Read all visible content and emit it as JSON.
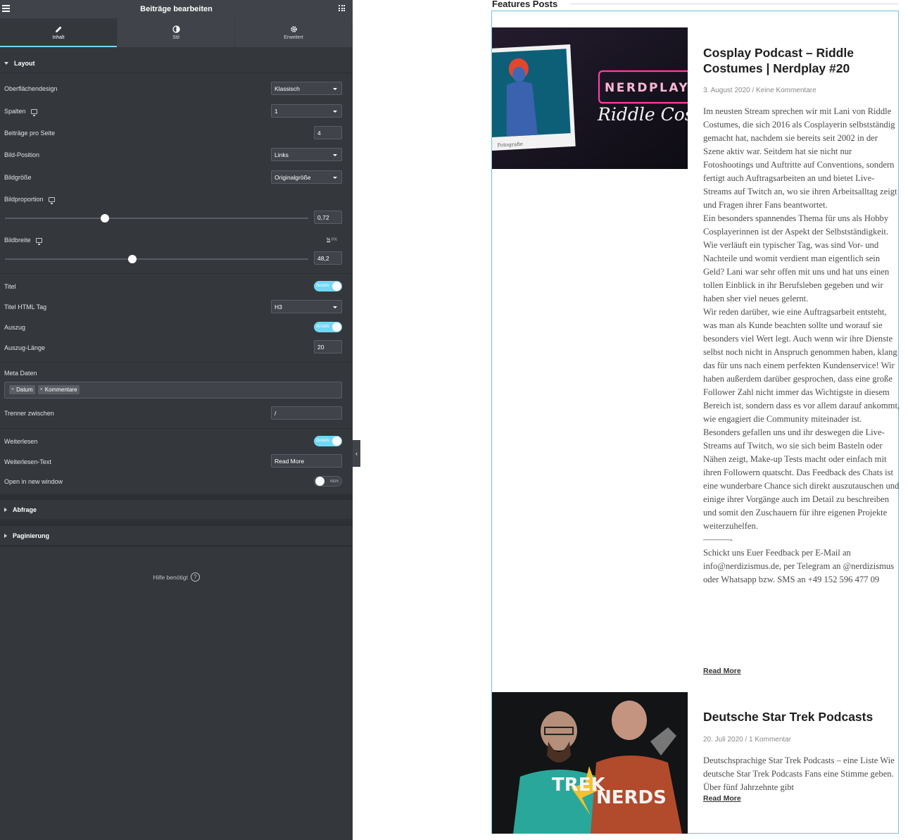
{
  "panel": {
    "title": "Beiträge bearbeiten",
    "tabs": [
      {
        "label": "Inhalt",
        "icon": "pencil-icon"
      },
      {
        "label": "Stil",
        "icon": "contrast-icon"
      },
      {
        "label": "Erweitert",
        "icon": "gear-icon"
      }
    ],
    "layout": {
      "heading": "Layout",
      "surface_label": "Oberflächendesign",
      "surface_value": "Klassisch",
      "columns_label": "Spalten",
      "columns_value": "1",
      "posts_per_page_label": "Beiträge pro Seite",
      "posts_per_page_value": "4",
      "image_position_label": "Bild-Position",
      "image_position_value": "Links",
      "image_size_label": "Bildgröße",
      "image_size_value": "Originalgröße",
      "image_ratio_label": "Bildproportion",
      "image_ratio_value": "0,72",
      "image_ratio_fraction": 0.33,
      "image_width_label": "Bildbreite",
      "image_width_value": "48,2",
      "image_width_fraction": 0.42,
      "image_width_units": [
        "%",
        "PX"
      ],
      "title_label": "Titel",
      "title_toggle": "ZEIGEN",
      "title_tag_label": "Titel HTML Tag",
      "title_tag_value": "H3",
      "excerpt_label": "Auszug",
      "excerpt_toggle": "ZEIGEN",
      "excerpt_length_label": "Auszug-Länge",
      "excerpt_length_value": "20",
      "meta_label": "Meta Daten",
      "meta_tags": [
        "Datum",
        "Kommentare"
      ],
      "separator_label": "Trenner zwischen",
      "separator_value": "/",
      "read_more_label": "Weiterlesen",
      "read_more_toggle": "ZEIGEN",
      "read_more_text_label": "Weiterlesen-Text",
      "read_more_text_value": "Read More",
      "new_window_label": "Open in new window",
      "new_window_toggle": "NEIN"
    },
    "query_heading": "Abfrage",
    "pagination_heading": "Paginierung",
    "help": "Hilfe benötigt"
  },
  "preview": {
    "section_title": "Features Posts",
    "posts": [
      {
        "title": "Cosplay Podcast – Riddle Costumes | Nerdplay #20",
        "meta": "3. August 2020 / Keine Kommentare",
        "excerpt": "Im neusten Stream sprechen wir mit Lani von Riddle Costumes, die sich 2016 als Cosplayerin selbstständig gemacht hat, nachdem sie bereits seit 2002 in der Szene aktiv war. Seitdem hat sie nicht nur Fotoshootings und Auftritte auf Conventions, sondern fertigt auch Auftragsarbeiten an und bietet Live-Streams auf Twitch an, wo sie ihren Arbeitsalltag zeigt und Fragen ihrer Fans beantwortet.\nEin besonders spannendes Thema für uns als Hobby Cosplayerinnen ist der Aspekt der Selbstständigkeit. Wie verläuft ein typischer Tag, was sind Vor- und Nachteile und womit verdient man eigentlich sein Geld? Lani war sehr offen mit uns und hat uns einen tollen Einblick in ihr Berufsleben gegeben und wir haben sher viel neues gelernt.\nWir reden darüber, wie eine Auftragsarbeit entsteht, was man als Kunde beachten sollte und worauf sie besonders viel Wert legt. Auch wenn wir ihre Dienste selbst noch nicht in Anspruch genommen haben, klang das für uns nach einem perfekten Kundenservice! Wir haben außerdem darüber gesprochen, dass eine große Follower Zahl nicht immer das Wichtigste in diesem Bereich ist, sondern dass es vor allem darauf ankommt, wie engagiert die Community miteinader ist.\nBesonders gefallen uns und ihr deswegen die Live-Streams auf Twitch, wo sie sich beim Basteln oder Nähen zeigt, Make-up Tests macht oder einfach mit ihren Followern quatscht. Das Feedback des Chats ist eine wunderbare Chance sich direkt auszutauschen und einige ihrer Vorgänge auch im Detail zu beschreiben und somit den Zuschauern für ihre eigenen Projekte weiterzuhelfen.\n———-\nSchickt uns Euer Feedback per E-Mail an info@nerdizismus.de, per Telegram an @nerdizismus oder Whatsapp bzw. SMS an +49 152 596 477 09",
        "read_more": "Read More",
        "image_text_1": "NERDPLAY",
        "image_text_2": "Riddle Costum"
      },
      {
        "title": "Deutsche Star Trek Podcasts",
        "meta": "20. Juli 2020 / 1 Kommentar",
        "excerpt": "Deutschsprachige Star Trek Podcasts – eine Liste Wie deutsche Star Trek Podcasts Fans eine Stimme geben. Über fünf Jahrzehnte gibt",
        "read_more": "Read More",
        "image_text_1": "TREK",
        "image_text_2": "NERDS"
      }
    ]
  }
}
